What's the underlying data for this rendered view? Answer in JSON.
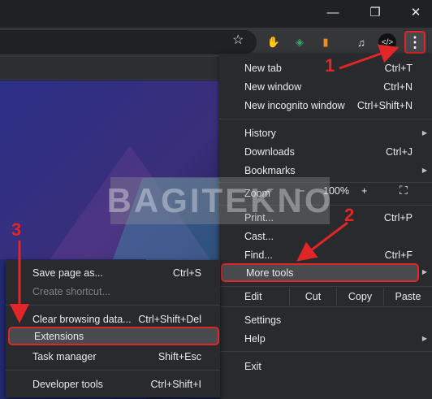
{
  "window_controls": {
    "minimize": "—",
    "restore": "❐",
    "close": "✕"
  },
  "toolbar": {
    "bookmark_star": "☆",
    "extensions": [
      {
        "name": "ublock",
        "glyph": "✋",
        "color": "#e02626"
      },
      {
        "name": "extension-2",
        "glyph": "◈",
        "color": "#3ba55d"
      },
      {
        "name": "extension-3",
        "glyph": "▮",
        "color": "#f08a24"
      },
      {
        "name": "playlist",
        "glyph": "♫",
        "color": "#e8eaed"
      },
      {
        "name": "code",
        "glyph": "</>",
        "color": "#e8eaed"
      }
    ],
    "menu_glyph": "⋮"
  },
  "menu": {
    "items": [
      {
        "label": "New tab",
        "shortcut": "Ctrl+T"
      },
      {
        "label": "New window",
        "shortcut": "Ctrl+N"
      },
      {
        "label": "New incognito window",
        "shortcut": "Ctrl+Shift+N"
      },
      {
        "label": "History",
        "shortcut": ""
      },
      {
        "label": "Downloads",
        "shortcut": "Ctrl+J"
      },
      {
        "label": "Bookmarks",
        "shortcut": ""
      },
      {
        "label": "Print...",
        "shortcut": "Ctrl+P"
      },
      {
        "label": "Cast...",
        "shortcut": ""
      },
      {
        "label": "Find...",
        "shortcut": "Ctrl+F"
      },
      {
        "label": "More tools",
        "shortcut": ""
      },
      {
        "label": "Settings",
        "shortcut": ""
      },
      {
        "label": "Help",
        "shortcut": ""
      },
      {
        "label": "Exit",
        "shortcut": ""
      }
    ],
    "zoom": {
      "label": "Zoom",
      "minus": "−",
      "value": "100%",
      "plus": "+",
      "fullscreen": "⛶"
    },
    "edit": {
      "label": "Edit",
      "cut": "Cut",
      "copy": "Copy",
      "paste": "Paste"
    },
    "submenu_arrow": "▶"
  },
  "submenu": {
    "items": [
      {
        "label": "Save page as...",
        "shortcut": "Ctrl+S"
      },
      {
        "label": "Create shortcut...",
        "shortcut": ""
      },
      {
        "label": "Clear browsing data...",
        "shortcut": "Ctrl+Shift+Del"
      },
      {
        "label": "Extensions",
        "shortcut": ""
      },
      {
        "label": "Task manager",
        "shortcut": "Shift+Esc"
      },
      {
        "label": "Developer tools",
        "shortcut": "Ctrl+Shift+I"
      }
    ]
  },
  "annotations": {
    "step1": "1",
    "step2": "2",
    "step3": "3"
  },
  "watermark": "BAGITEKNO",
  "colors": {
    "annotation": "#e02626",
    "menu_bg": "#292a2d",
    "toolbar_bg": "#35363a"
  }
}
